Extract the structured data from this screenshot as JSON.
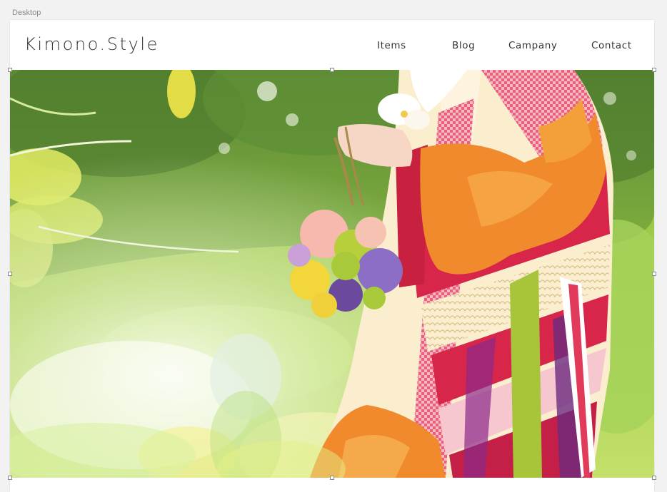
{
  "artboard": {
    "label": "Desktop"
  },
  "header": {
    "logo": "Kimono.Style",
    "nav": [
      {
        "label": "Items"
      },
      {
        "label": "Blog"
      },
      {
        "label": "Campany"
      },
      {
        "label": "Contact"
      }
    ]
  },
  "hero": {
    "image_subject": "woman in a red, orange and cream kimono holding a flower bouquet in a sunlit garden"
  },
  "colors": {
    "canvas_background": "#f2f2f2",
    "artboard_background": "#ffffff",
    "text": "#333333",
    "label": "#8a8a8a",
    "kimono_red": "#d8254a",
    "kimono_orange": "#f08a2c",
    "foliage_green": "#8fbf4a"
  }
}
